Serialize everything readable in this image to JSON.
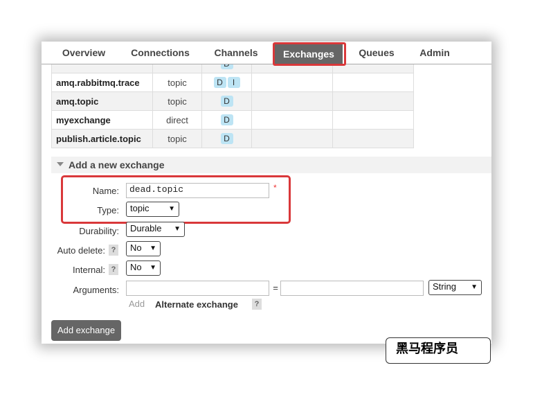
{
  "nav": {
    "tabs": [
      {
        "label": "Overview"
      },
      {
        "label": "Connections"
      },
      {
        "label": "Channels"
      },
      {
        "label": "Exchanges"
      },
      {
        "label": "Queues"
      },
      {
        "label": "Admin"
      }
    ],
    "active_tab": "Exchanges"
  },
  "exchanges": [
    {
      "name": "amq.rabbitmq.trace",
      "type": "topic",
      "features": [
        "D",
        "I"
      ]
    },
    {
      "name": "amq.topic",
      "type": "topic",
      "features": [
        "D"
      ]
    },
    {
      "name": "myexchange",
      "type": "direct",
      "features": [
        "D"
      ]
    },
    {
      "name": "publish.article.topic",
      "type": "topic",
      "features": [
        "D"
      ]
    }
  ],
  "add_exchange": {
    "section_title": "Add a new exchange",
    "name_label": "Name:",
    "name_value": "dead.topic",
    "required_mark": "*",
    "type_label": "Type:",
    "type_value": "topic",
    "durability_label": "Durability:",
    "durability_value": "Durable",
    "auto_delete_label": "Auto delete:",
    "auto_delete_value": "No",
    "internal_label": "Internal:",
    "internal_value": "No",
    "arguments_label": "Arguments:",
    "arguments_equals": "=",
    "arguments_type_value": "String",
    "add_link": "Add",
    "alternate_exchange": "Alternate exchange",
    "help_mark": "?",
    "submit_label": "Add exchange"
  },
  "watermark": "黑马程序员",
  "colors": {
    "highlight": "#d9383a",
    "active_tab": "#666666",
    "badge": "#bde4f4"
  }
}
